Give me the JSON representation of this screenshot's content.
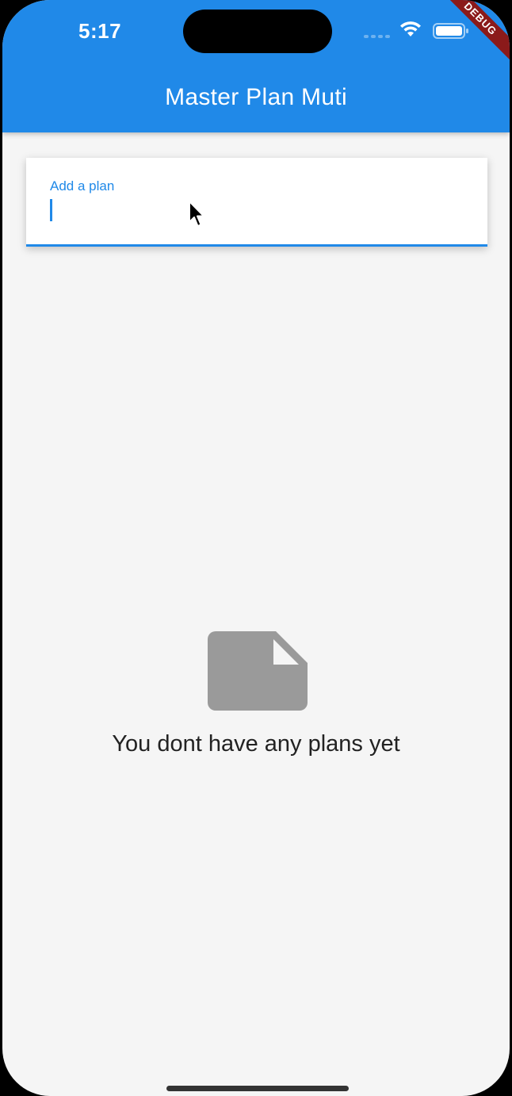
{
  "status_bar": {
    "time": "5:17",
    "signal_icon": "cellular-signal-icon",
    "wifi_icon": "wifi-icon",
    "battery_icon": "battery-icon"
  },
  "debug_banner": "DEBUG",
  "app_bar": {
    "title": "Master Plan Muti"
  },
  "plan_input": {
    "label": "Add a plan",
    "value": ""
  },
  "empty_state": {
    "icon": "note-icon",
    "message": "You dont have any plans yet"
  },
  "colors": {
    "primary": "#2089e8",
    "background": "#f5f5f5",
    "empty_icon": "#9a9a9a",
    "debug_ribbon": "#8b1a1a"
  }
}
